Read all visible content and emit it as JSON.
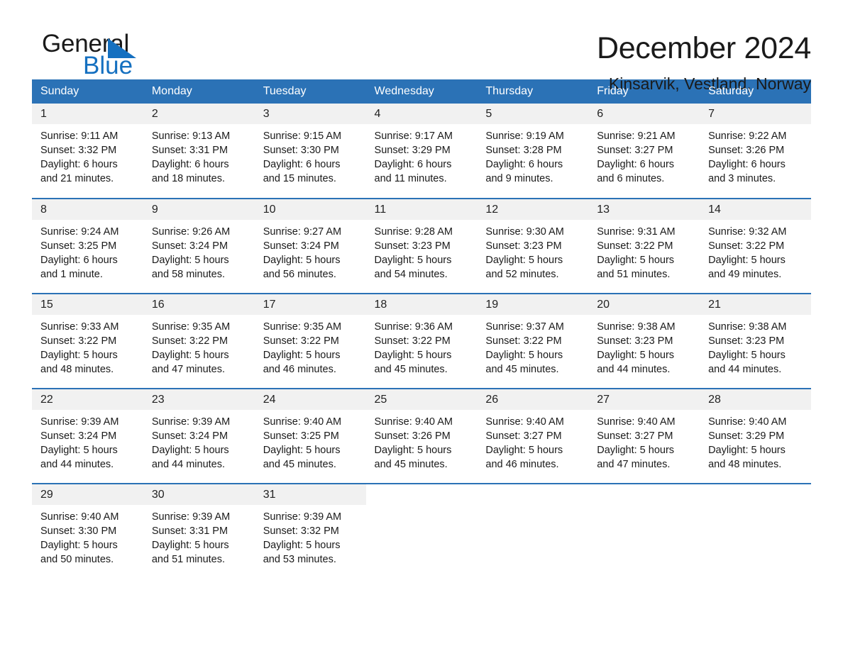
{
  "brand": {
    "name_part1": "General",
    "name_part2": "Blue",
    "accent_color": "#1570c0"
  },
  "header": {
    "month_title": "December 2024",
    "location": "Kinsarvik, Vestland, Norway"
  },
  "calendar": {
    "header_color": "#2b72b6",
    "daynum_band_color": "#f1f1f1",
    "weekday_headers": [
      "Sunday",
      "Monday",
      "Tuesday",
      "Wednesday",
      "Thursday",
      "Friday",
      "Saturday"
    ],
    "weeks": [
      [
        {
          "day": "1",
          "sunrise": "Sunrise: 9:11 AM",
          "sunset": "Sunset: 3:32 PM",
          "daylight_line1": "Daylight: 6 hours",
          "daylight_line2": "and 21 minutes."
        },
        {
          "day": "2",
          "sunrise": "Sunrise: 9:13 AM",
          "sunset": "Sunset: 3:31 PM",
          "daylight_line1": "Daylight: 6 hours",
          "daylight_line2": "and 18 minutes."
        },
        {
          "day": "3",
          "sunrise": "Sunrise: 9:15 AM",
          "sunset": "Sunset: 3:30 PM",
          "daylight_line1": "Daylight: 6 hours",
          "daylight_line2": "and 15 minutes."
        },
        {
          "day": "4",
          "sunrise": "Sunrise: 9:17 AM",
          "sunset": "Sunset: 3:29 PM",
          "daylight_line1": "Daylight: 6 hours",
          "daylight_line2": "and 11 minutes."
        },
        {
          "day": "5",
          "sunrise": "Sunrise: 9:19 AM",
          "sunset": "Sunset: 3:28 PM",
          "daylight_line1": "Daylight: 6 hours",
          "daylight_line2": "and 9 minutes."
        },
        {
          "day": "6",
          "sunrise": "Sunrise: 9:21 AM",
          "sunset": "Sunset: 3:27 PM",
          "daylight_line1": "Daylight: 6 hours",
          "daylight_line2": "and 6 minutes."
        },
        {
          "day": "7",
          "sunrise": "Sunrise: 9:22 AM",
          "sunset": "Sunset: 3:26 PM",
          "daylight_line1": "Daylight: 6 hours",
          "daylight_line2": "and 3 minutes."
        }
      ],
      [
        {
          "day": "8",
          "sunrise": "Sunrise: 9:24 AM",
          "sunset": "Sunset: 3:25 PM",
          "daylight_line1": "Daylight: 6 hours",
          "daylight_line2": "and 1 minute."
        },
        {
          "day": "9",
          "sunrise": "Sunrise: 9:26 AM",
          "sunset": "Sunset: 3:24 PM",
          "daylight_line1": "Daylight: 5 hours",
          "daylight_line2": "and 58 minutes."
        },
        {
          "day": "10",
          "sunrise": "Sunrise: 9:27 AM",
          "sunset": "Sunset: 3:24 PM",
          "daylight_line1": "Daylight: 5 hours",
          "daylight_line2": "and 56 minutes."
        },
        {
          "day": "11",
          "sunrise": "Sunrise: 9:28 AM",
          "sunset": "Sunset: 3:23 PM",
          "daylight_line1": "Daylight: 5 hours",
          "daylight_line2": "and 54 minutes."
        },
        {
          "day": "12",
          "sunrise": "Sunrise: 9:30 AM",
          "sunset": "Sunset: 3:23 PM",
          "daylight_line1": "Daylight: 5 hours",
          "daylight_line2": "and 52 minutes."
        },
        {
          "day": "13",
          "sunrise": "Sunrise: 9:31 AM",
          "sunset": "Sunset: 3:22 PM",
          "daylight_line1": "Daylight: 5 hours",
          "daylight_line2": "and 51 minutes."
        },
        {
          "day": "14",
          "sunrise": "Sunrise: 9:32 AM",
          "sunset": "Sunset: 3:22 PM",
          "daylight_line1": "Daylight: 5 hours",
          "daylight_line2": "and 49 minutes."
        }
      ],
      [
        {
          "day": "15",
          "sunrise": "Sunrise: 9:33 AM",
          "sunset": "Sunset: 3:22 PM",
          "daylight_line1": "Daylight: 5 hours",
          "daylight_line2": "and 48 minutes."
        },
        {
          "day": "16",
          "sunrise": "Sunrise: 9:35 AM",
          "sunset": "Sunset: 3:22 PM",
          "daylight_line1": "Daylight: 5 hours",
          "daylight_line2": "and 47 minutes."
        },
        {
          "day": "17",
          "sunrise": "Sunrise: 9:35 AM",
          "sunset": "Sunset: 3:22 PM",
          "daylight_line1": "Daylight: 5 hours",
          "daylight_line2": "and 46 minutes."
        },
        {
          "day": "18",
          "sunrise": "Sunrise: 9:36 AM",
          "sunset": "Sunset: 3:22 PM",
          "daylight_line1": "Daylight: 5 hours",
          "daylight_line2": "and 45 minutes."
        },
        {
          "day": "19",
          "sunrise": "Sunrise: 9:37 AM",
          "sunset": "Sunset: 3:22 PM",
          "daylight_line1": "Daylight: 5 hours",
          "daylight_line2": "and 45 minutes."
        },
        {
          "day": "20",
          "sunrise": "Sunrise: 9:38 AM",
          "sunset": "Sunset: 3:23 PM",
          "daylight_line1": "Daylight: 5 hours",
          "daylight_line2": "and 44 minutes."
        },
        {
          "day": "21",
          "sunrise": "Sunrise: 9:38 AM",
          "sunset": "Sunset: 3:23 PM",
          "daylight_line1": "Daylight: 5 hours",
          "daylight_line2": "and 44 minutes."
        }
      ],
      [
        {
          "day": "22",
          "sunrise": "Sunrise: 9:39 AM",
          "sunset": "Sunset: 3:24 PM",
          "daylight_line1": "Daylight: 5 hours",
          "daylight_line2": "and 44 minutes."
        },
        {
          "day": "23",
          "sunrise": "Sunrise: 9:39 AM",
          "sunset": "Sunset: 3:24 PM",
          "daylight_line1": "Daylight: 5 hours",
          "daylight_line2": "and 44 minutes."
        },
        {
          "day": "24",
          "sunrise": "Sunrise: 9:40 AM",
          "sunset": "Sunset: 3:25 PM",
          "daylight_line1": "Daylight: 5 hours",
          "daylight_line2": "and 45 minutes."
        },
        {
          "day": "25",
          "sunrise": "Sunrise: 9:40 AM",
          "sunset": "Sunset: 3:26 PM",
          "daylight_line1": "Daylight: 5 hours",
          "daylight_line2": "and 45 minutes."
        },
        {
          "day": "26",
          "sunrise": "Sunrise: 9:40 AM",
          "sunset": "Sunset: 3:27 PM",
          "daylight_line1": "Daylight: 5 hours",
          "daylight_line2": "and 46 minutes."
        },
        {
          "day": "27",
          "sunrise": "Sunrise: 9:40 AM",
          "sunset": "Sunset: 3:27 PM",
          "daylight_line1": "Daylight: 5 hours",
          "daylight_line2": "and 47 minutes."
        },
        {
          "day": "28",
          "sunrise": "Sunrise: 9:40 AM",
          "sunset": "Sunset: 3:29 PM",
          "daylight_line1": "Daylight: 5 hours",
          "daylight_line2": "and 48 minutes."
        }
      ],
      [
        {
          "day": "29",
          "sunrise": "Sunrise: 9:40 AM",
          "sunset": "Sunset: 3:30 PM",
          "daylight_line1": "Daylight: 5 hours",
          "daylight_line2": "and 50 minutes."
        },
        {
          "day": "30",
          "sunrise": "Sunrise: 9:39 AM",
          "sunset": "Sunset: 3:31 PM",
          "daylight_line1": "Daylight: 5 hours",
          "daylight_line2": "and 51 minutes."
        },
        {
          "day": "31",
          "sunrise": "Sunrise: 9:39 AM",
          "sunset": "Sunset: 3:32 PM",
          "daylight_line1": "Daylight: 5 hours",
          "daylight_line2": "and 53 minutes."
        },
        {
          "day": "",
          "sunrise": "",
          "sunset": "",
          "daylight_line1": "",
          "daylight_line2": ""
        },
        {
          "day": "",
          "sunrise": "",
          "sunset": "",
          "daylight_line1": "",
          "daylight_line2": ""
        },
        {
          "day": "",
          "sunrise": "",
          "sunset": "",
          "daylight_line1": "",
          "daylight_line2": ""
        },
        {
          "day": "",
          "sunrise": "",
          "sunset": "",
          "daylight_line1": "",
          "daylight_line2": ""
        }
      ]
    ]
  }
}
